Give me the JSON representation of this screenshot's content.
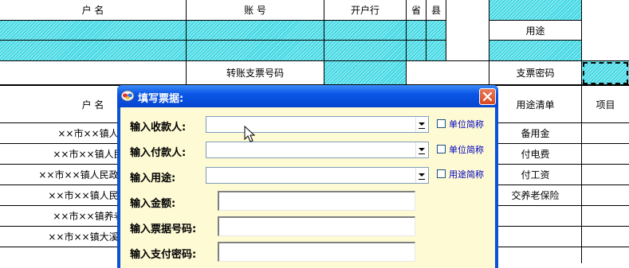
{
  "header": {
    "account_name": "户      名",
    "account_no": "账      号",
    "bank": "开户行",
    "province": "省",
    "county": "县",
    "purpose": "用途",
    "transfer_check_no": "转账支票号码",
    "check_password": "支票密码"
  },
  "lower_header": {
    "name": "户      名",
    "purpose_list": "用途清单",
    "item": "项目"
  },
  "rows": [
    {
      "name": "××市××镇人民",
      "purpose": "备用金"
    },
    {
      "name": "××市××镇人民政",
      "purpose": "付电费"
    },
    {
      "name": "××市××镇人民政府康庄",
      "purpose": "付工资"
    },
    {
      "name": "××市××镇人民政府",
      "purpose": "交养老保险"
    },
    {
      "name": "××市××镇养老肝",
      "purpose": ""
    },
    {
      "name": "××市××镇大溪滩村",
      "purpose": ""
    }
  ],
  "dialog": {
    "title": "填写票据:",
    "payee_label": "输入收款人:",
    "payer_label": "输入付款人:",
    "usage_label": "输入用途:",
    "amount_label": "输入金额:",
    "ticket_no_label": "输入票据号码:",
    "pay_password_label": "输入支付密码:",
    "payee_value": "",
    "payer_value": "",
    "usage_value": "",
    "amount_value": "",
    "ticket_no_value": "",
    "pay_password_value": "",
    "payee_short_label": "单位简称",
    "payer_short_label": "单位简称",
    "usage_short_label": "用途简称"
  }
}
